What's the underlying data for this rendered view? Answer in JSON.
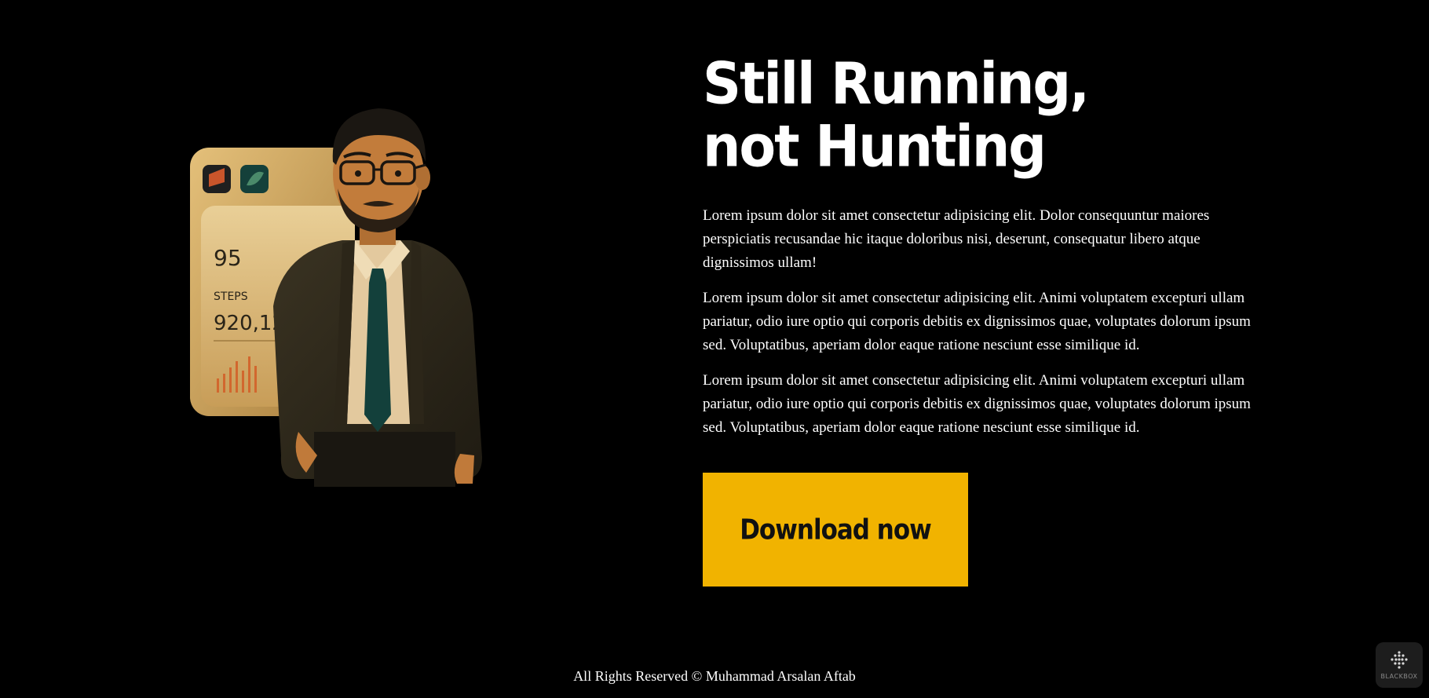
{
  "hero": {
    "line1": "Still Running,",
    "line2": "not Hunting"
  },
  "paragraphs": [
    "Lorem ipsum dolor sit amet consectetur adipisicing elit. Dolor consequuntur maiores perspiciatis recusandae hic itaque doloribus nisi, deserunt, consequatur libero atque dignissimos ullam!",
    "Lorem ipsum dolor sit amet consectetur adipisicing elit. Animi voluptatem excepturi ullam pariatur, odio iure optio qui corporis debitis ex dignissimos quae, voluptates dolorum ipsum sed. Voluptatibus, aperiam dolor eaque ratione nesciunt esse similique id.",
    "Lorem ipsum dolor sit amet consectetur adipisicing elit. Animi voluptatem excepturi ullam pariatur, odio iure optio qui corporis debitis ex dignissimos quae, voluptates dolorum ipsum sed. Voluptatibus, aperiam dolor eaque ratione nesciunt esse similique id."
  ],
  "cta": {
    "label": "Download now"
  },
  "fitness_card": {
    "value_top": "95",
    "steps_label": "STEPS",
    "steps_value": "920,12"
  },
  "footer": {
    "text": "All Rights Reserved © Muhammad Arsalan Aftab"
  },
  "widget": {
    "label": "BLACKBOX",
    "icon": "dots-grid-icon"
  },
  "colors": {
    "background": "#000000",
    "accent": "#f1b300",
    "text": "#ffffff",
    "card": "#c9a05c"
  }
}
